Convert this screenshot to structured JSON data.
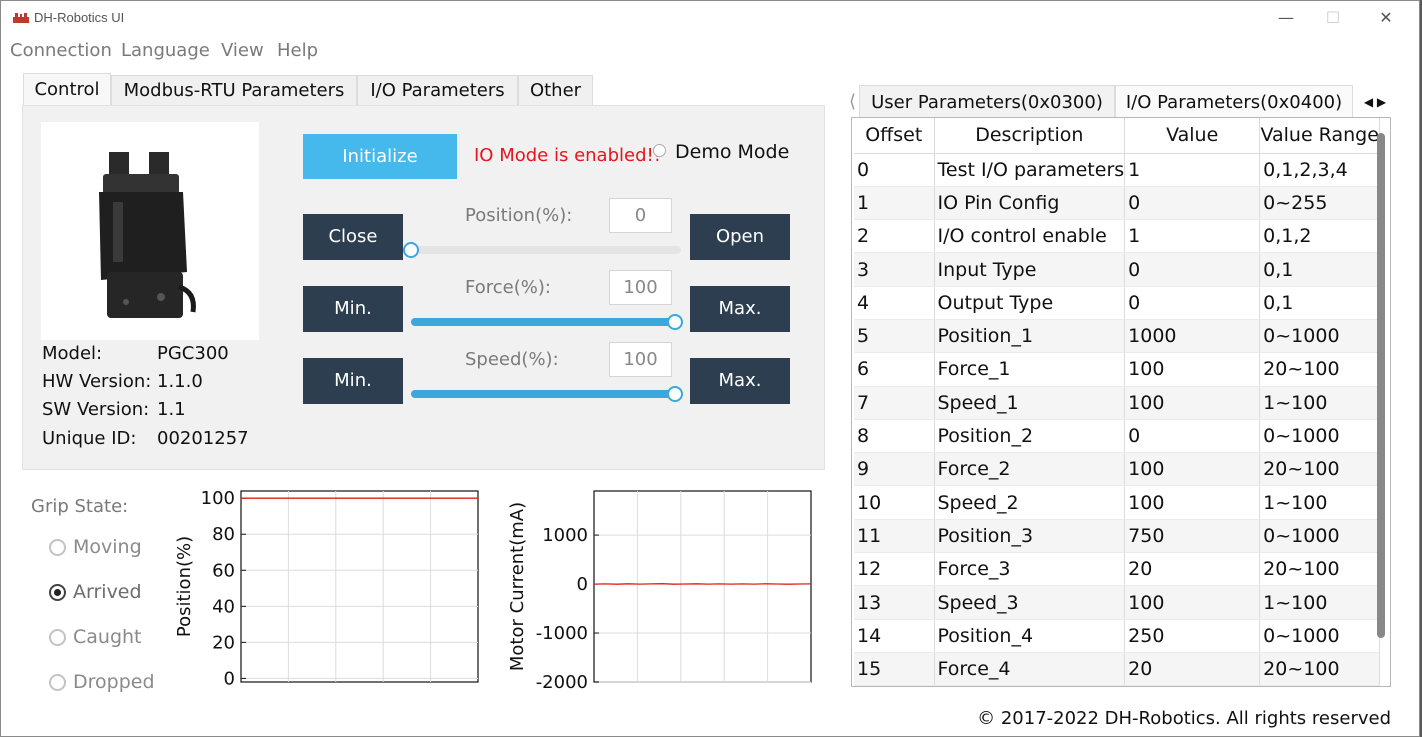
{
  "window": {
    "title": "DH-Robotics UI",
    "minimize": "—",
    "maximize": "☐",
    "close": "✕"
  },
  "menu": [
    "Connection",
    "Language",
    "View",
    "Help"
  ],
  "left_tabs": [
    "Control",
    "Modbus-RTU Parameters",
    "I/O Parameters",
    "Other"
  ],
  "device": {
    "model_label": "Model:",
    "model": "PGC300",
    "hw_label": "HW Version:",
    "hw": "1.1.0",
    "sw_label": "SW Version:",
    "sw": "1.1",
    "uid_label": "Unique ID:",
    "uid": "00201257"
  },
  "control": {
    "initialize": "Initialize",
    "io_message": "IO Mode is enabled!!",
    "demo_mode": "Demo Mode",
    "close": "Close",
    "open": "Open",
    "position_label": "Position(%):",
    "position_value": "0",
    "force_label": "Force(%):",
    "force_value": "100",
    "speed_label": "Speed(%):",
    "speed_value": "100",
    "min": "Min.",
    "max": "Max.",
    "position_level": 0,
    "force_level": 100,
    "speed_level": 100
  },
  "grip": {
    "title": "Grip State:",
    "options": [
      "Moving",
      "Arrived",
      "Caught",
      "Dropped"
    ],
    "selected": "Arrived"
  },
  "chart_data": [
    {
      "type": "line",
      "ylabel": "Position(%)",
      "ylim": [
        -2,
        104
      ],
      "yticks": [
        "100",
        "80",
        "60",
        "40",
        "20",
        "0"
      ],
      "series": [
        {
          "values": [
            100,
            100,
            100,
            100,
            100,
            100,
            100,
            100,
            100,
            100
          ]
        }
      ],
      "grid": true
    },
    {
      "type": "line",
      "ylabel": "Motor Current(mA)",
      "ylim": [
        -2000,
        1900
      ],
      "yticks": [
        "1000",
        "0",
        "-1000",
        "-2000"
      ],
      "series": [
        {
          "values": [
            0,
            4,
            -3,
            6,
            -2,
            3,
            8,
            -4,
            2,
            5,
            -1,
            3,
            0,
            4,
            -2,
            6,
            1,
            -3,
            2,
            4
          ]
        }
      ],
      "grid": true
    }
  ],
  "right_tabs": [
    "User Parameters(0x0300)",
    "I/O Parameters(0x0400)"
  ],
  "table": {
    "headers": [
      "Offset",
      "Description",
      "Value",
      "Value Range"
    ],
    "rows": [
      [
        "0",
        "Test I/O parameters",
        "1",
        "0,1,2,3,4"
      ],
      [
        "1",
        "IO Pin Config",
        "0",
        "0~255"
      ],
      [
        "2",
        "I/O control enable",
        "1",
        "0,1,2"
      ],
      [
        "3",
        "Input Type",
        "0",
        "0,1"
      ],
      [
        "4",
        "Output Type",
        "0",
        "0,1"
      ],
      [
        "5",
        "Position_1",
        "1000",
        "0~1000"
      ],
      [
        "6",
        "Force_1",
        "100",
        "20~100"
      ],
      [
        "7",
        "Speed_1",
        "100",
        "1~100"
      ],
      [
        "8",
        "Position_2",
        "0",
        "0~1000"
      ],
      [
        "9",
        "Force_2",
        "100",
        "20~100"
      ],
      [
        "10",
        "Speed_2",
        "100",
        "1~100"
      ],
      [
        "11",
        "Position_3",
        "750",
        "0~1000"
      ],
      [
        "12",
        "Force_3",
        "20",
        "20~100"
      ],
      [
        "13",
        "Speed_3",
        "100",
        "1~100"
      ],
      [
        "14",
        "Position_4",
        "250",
        "0~1000"
      ],
      [
        "15",
        "Force_4",
        "20",
        "20~100"
      ]
    ]
  },
  "footer": "© 2017-2022 DH-Robotics. All rights reserved",
  "colors": {
    "accent": "#45b8ec",
    "dark_button": "#2c3e50",
    "warning": "#e8141c",
    "plot_line": "#e0201a"
  }
}
